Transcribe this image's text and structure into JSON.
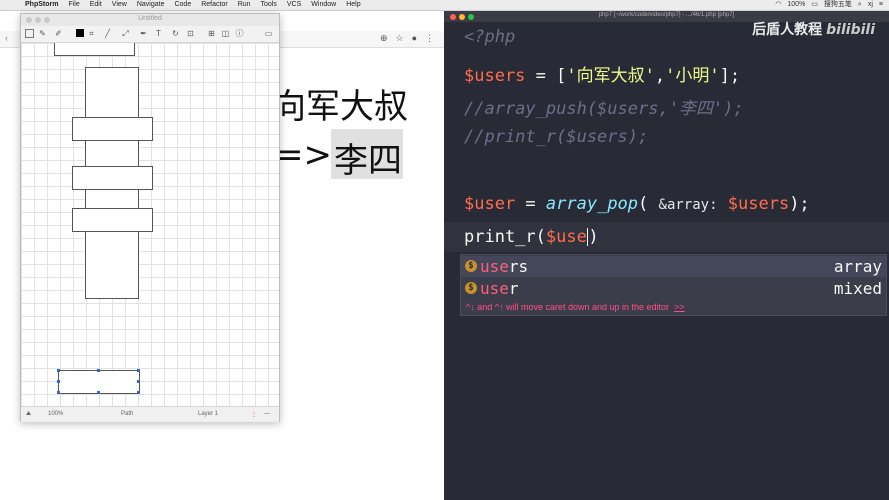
{
  "menubar": {
    "app": "PhpStorm",
    "items": [
      "File",
      "Edit",
      "View",
      "Navigate",
      "Code",
      "Refactor",
      "Run",
      "Tools",
      "VCS",
      "Window",
      "Help"
    ],
    "battery": "100%",
    "ime": "搜狗五笔",
    "user": "xj"
  },
  "slide": {
    "line1": "向军大叔",
    "arrow": "=>",
    "line2": "李四"
  },
  "draw_app": {
    "title": "Untitled",
    "zoom": "100%",
    "path_label": "Path",
    "layer_label": "Layer 1"
  },
  "ide": {
    "window_title": "php7 [~/work/code/video/php7] - .../46/1.php [php7]",
    "watermark": "后盾人教程",
    "watermark_brand": "bilibili",
    "lines": {
      "open_tag": "<?php",
      "users_var": "$users",
      "users_eq": " = [",
      "str1": "'向军大叔'",
      "comma": ",",
      "str2": "'小明'",
      "users_end": "];",
      "comment1": "//array_push($users,'李四');",
      "comment2": "//print_r($users);",
      "user_var": "$user",
      "user_eq": " = ",
      "fn_pop": "array_pop",
      "paren_open": "( ",
      "param_hint": "&array:",
      "users_arg": " $users",
      "pop_end": ");",
      "print_fn": "print_r(",
      "typed": "$use",
      "close_paren": ")"
    },
    "completion": {
      "items": [
        {
          "match": "use",
          "rest": "rs",
          "type": "array"
        },
        {
          "match": "use",
          "rest": "r",
          "type": "mixed"
        }
      ],
      "icon_letter": "$",
      "tip": "^↓ and ^↑ will move caret down and up in the editor",
      "tip_link": ">>"
    }
  },
  "colors": {
    "editor_bg": "#282a36",
    "variable": "#ff6e4a",
    "string": "#f1fa8c",
    "comment": "#6b7089",
    "function": "#8be9fd",
    "tip": "#ff4f8b"
  }
}
